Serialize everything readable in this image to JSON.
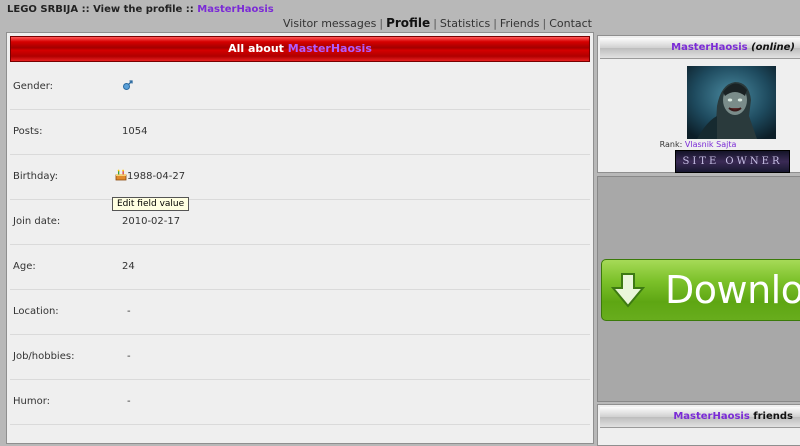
{
  "breadcrumb": {
    "site": "LEGO SRBIJA",
    "sep1": " :: ",
    "page": "View the profile",
    "sep2": " :: ",
    "username": "MasterHaosis"
  },
  "nav": {
    "items": [
      "Visitor messages",
      "Profile",
      "Statistics",
      "Friends",
      "Contact"
    ],
    "active": "Profile",
    "separator": "|"
  },
  "main": {
    "header_prefix": "All about ",
    "header_username": "MasterHaosis",
    "fields": [
      {
        "label": "Gender:",
        "value": "",
        "icon": "male-gender-icon"
      },
      {
        "label": "Posts:",
        "value": "1054"
      },
      {
        "label": "Birthday:",
        "value": "1988-04-27",
        "icon": "birthday-cake-icon"
      },
      {
        "label": "Join date:",
        "value": "2010-02-17"
      },
      {
        "label": "Age:",
        "value": "24"
      },
      {
        "label": "Location:",
        "value": "-"
      },
      {
        "label": "Job/hobbies:",
        "value": "-"
      },
      {
        "label": "Humor:",
        "value": "-"
      }
    ],
    "tooltip": "Edit field value"
  },
  "sidebar": {
    "profile_box": {
      "username": "MasterHaosis",
      "status": "(online)",
      "rank_label": "Rank: ",
      "rank_name": "Vlasnik Sajta",
      "badge_text": "SITE OWNER"
    },
    "ad": {
      "button_label": "Downloa",
      "icon": "download-arrow-icon"
    },
    "friends_box": {
      "username": "MasterHaosis",
      "suffix": " friends"
    }
  },
  "colors": {
    "accent_username": "#7b2bd6",
    "header_red": "#c00000",
    "download_green": "#6db21f"
  }
}
